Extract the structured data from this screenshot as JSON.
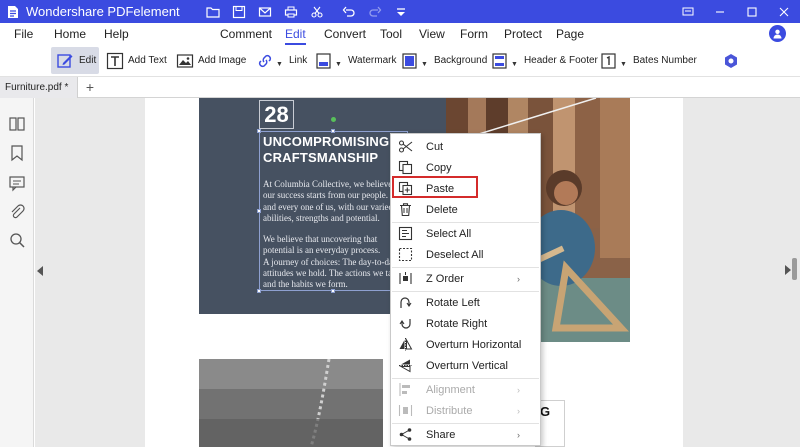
{
  "titlebar": {
    "app_title": "Wondershare PDFelement",
    "bg_color": "#3b4be0",
    "quick_access": [
      {
        "name": "folder-icon",
        "glyph": "folder"
      },
      {
        "name": "save-icon",
        "glyph": "save"
      },
      {
        "name": "mail-icon",
        "glyph": "mail"
      },
      {
        "name": "print-icon",
        "glyph": "print"
      },
      {
        "name": "scissors-icon",
        "glyph": "scissors"
      },
      {
        "name": "undo-icon",
        "glyph": "undo"
      },
      {
        "name": "redo-icon",
        "glyph": "redo"
      },
      {
        "name": "customize-dropdown-icon",
        "glyph": "dropdown"
      }
    ],
    "window_controls": [
      "feedback-icon",
      "minimize-icon",
      "maximize-icon",
      "close-icon"
    ]
  },
  "menubar": {
    "items": [
      "File",
      "Home",
      "Help",
      "Comment",
      "Edit",
      "Convert",
      "Tool",
      "View",
      "Form",
      "Protect",
      "Page"
    ],
    "active": "Edit"
  },
  "toolbar": {
    "edit": "Edit",
    "add_text": "Add Text",
    "add_image": "Add Image",
    "link": "Link",
    "watermark": "Watermark",
    "background": "Background",
    "header_footer": "Header & Footer",
    "bates_number": "Bates Number"
  },
  "tabs": {
    "doc_tab": "Furniture.pdf *",
    "add_tab": "+"
  },
  "document": {
    "page_number": "28",
    "headline_1": "UNCOMPROMISING",
    "headline_2": "CRAFTSMANSHIP",
    "para1": [
      "At Columbia Collective, we believe",
      "our success starts from our people.",
      "and every one of us, with our varied",
      "abilities, strengths and potential."
    ],
    "para2": [
      "We believe that uncovering that",
      "potential is an everyday process.",
      "A journey of choices: The day-to-day",
      "attitudes we hold. The actions we take",
      "and the habits we form."
    ],
    "partial_heading": "G"
  },
  "context_menu": {
    "cut": "Cut",
    "copy": "Copy",
    "paste": "Paste",
    "delete": "Delete",
    "select_all": "Select All",
    "deselect_all": "Deselect All",
    "z_order": "Z Order",
    "rotate_left": "Rotate Left",
    "rotate_right": "Rotate Right",
    "overturn_horizontal": "Overturn Horizontal",
    "overturn_vertical": "Overturn Vertical",
    "alignment": "Alignment",
    "distribute": "Distribute",
    "share": "Share",
    "submenu_arrow": "›",
    "highlight_color": "#d42b2b"
  }
}
